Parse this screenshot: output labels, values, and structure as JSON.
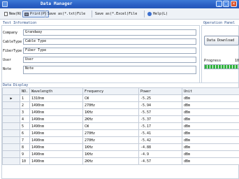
{
  "window": {
    "title": "Data Manager"
  },
  "toolbar": {
    "new_label": "New(N)",
    "print_label": "Print(P)",
    "save_txt_label": "Save as(*.txt)File",
    "save_excel_label": "Save as(*.Excel)File",
    "help_label": "Help(L)"
  },
  "test_info": {
    "group_label": "Test Information",
    "fields": [
      {
        "label": "Company",
        "value": "Grandway"
      },
      {
        "label": "CableType",
        "value": "Cable Type"
      },
      {
        "label": "FiberType",
        "value": "Fiber Type"
      },
      {
        "label": "User",
        "value": "User"
      },
      {
        "label": "Note",
        "value": "Note"
      }
    ]
  },
  "operation_panel": {
    "group_label": "Operation Panel",
    "download_button_label": "Data Download",
    "progress_label": "Progress",
    "progress_value_text": "10",
    "progress_fraction": 1.0
  },
  "data_display": {
    "group_label": "Data Display",
    "selected_row_marker": "▶",
    "columns": [
      "NO.",
      "Wavelength",
      "Frequency",
      "Power",
      "Unit"
    ],
    "rows": [
      [
        "1",
        "1310nm",
        "CW",
        "-5.25",
        "dBm"
      ],
      [
        "2",
        "1490nm",
        "270Hz",
        "-5.94",
        "dBm"
      ],
      [
        "3",
        "1490nm",
        "1KHz",
        "-5.57",
        "dBm"
      ],
      [
        "4",
        "1490nm",
        "2KHz",
        "-5.37",
        "dBm"
      ],
      [
        "5",
        "1490nm",
        "CW",
        "-5.17",
        "dBm"
      ],
      [
        "6",
        "1490nm",
        "270Hz",
        "-5.41",
        "dBm"
      ],
      [
        "7",
        "1490nm",
        "270Hz",
        "-5.42",
        "dBm"
      ],
      [
        "8",
        "1490nm",
        "1KHz",
        "-4.88",
        "dBm"
      ],
      [
        "9",
        "1490nm",
        "1KHz",
        "-4.9",
        "dBm"
      ],
      [
        "10",
        "1490nm",
        "2KHz",
        "-4.57",
        "dBm"
      ]
    ]
  },
  "colors": {
    "titlebar": "#2a5fc4",
    "progress": "#2fb43b",
    "close_button": "#d9502a"
  }
}
